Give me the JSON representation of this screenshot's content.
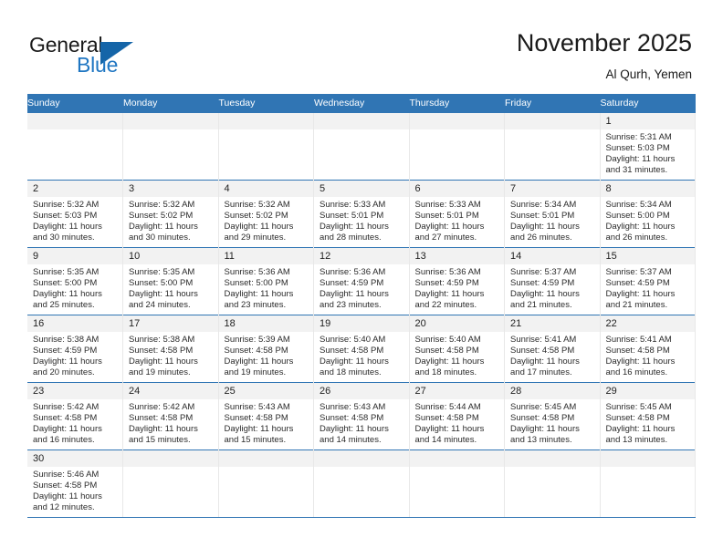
{
  "logo": {
    "word1": "General",
    "word2": "Blue",
    "triangle_color": "#1565a8",
    "blue_color": "#1f76c2",
    "icon": "triangle-flag-icon"
  },
  "header": {
    "title": "November 2025",
    "subtitle": "Al Qurh, Yemen"
  },
  "theme": {
    "header_row_bg": "#3075b4",
    "daynum_strip_bg": "#f2f2f2",
    "row_divider": "#3075b4",
    "column_divider": "#e8e8e8"
  },
  "weekday_headers": [
    "Sunday",
    "Monday",
    "Tuesday",
    "Wednesday",
    "Thursday",
    "Friday",
    "Saturday"
  ],
  "labels": {
    "sunrise": "Sunrise:",
    "sunset": "Sunset:",
    "daylight": "Daylight:"
  },
  "weeks": [
    [
      {
        "day": "",
        "empty": true
      },
      {
        "day": "",
        "empty": true
      },
      {
        "day": "",
        "empty": true
      },
      {
        "day": "",
        "empty": true
      },
      {
        "day": "",
        "empty": true
      },
      {
        "day": "",
        "empty": true
      },
      {
        "day": "1",
        "sunrise": "Sunrise: 5:31 AM",
        "sunset": "Sunset: 5:03 PM",
        "daylight": "Daylight: 11 hours and 31 minutes."
      }
    ],
    [
      {
        "day": "2",
        "sunrise": "Sunrise: 5:32 AM",
        "sunset": "Sunset: 5:03 PM",
        "daylight": "Daylight: 11 hours and 30 minutes."
      },
      {
        "day": "3",
        "sunrise": "Sunrise: 5:32 AM",
        "sunset": "Sunset: 5:02 PM",
        "daylight": "Daylight: 11 hours and 30 minutes."
      },
      {
        "day": "4",
        "sunrise": "Sunrise: 5:32 AM",
        "sunset": "Sunset: 5:02 PM",
        "daylight": "Daylight: 11 hours and 29 minutes."
      },
      {
        "day": "5",
        "sunrise": "Sunrise: 5:33 AM",
        "sunset": "Sunset: 5:01 PM",
        "daylight": "Daylight: 11 hours and 28 minutes."
      },
      {
        "day": "6",
        "sunrise": "Sunrise: 5:33 AM",
        "sunset": "Sunset: 5:01 PM",
        "daylight": "Daylight: 11 hours and 27 minutes."
      },
      {
        "day": "7",
        "sunrise": "Sunrise: 5:34 AM",
        "sunset": "Sunset: 5:01 PM",
        "daylight": "Daylight: 11 hours and 26 minutes."
      },
      {
        "day": "8",
        "sunrise": "Sunrise: 5:34 AM",
        "sunset": "Sunset: 5:00 PM",
        "daylight": "Daylight: 11 hours and 26 minutes."
      }
    ],
    [
      {
        "day": "9",
        "sunrise": "Sunrise: 5:35 AM",
        "sunset": "Sunset: 5:00 PM",
        "daylight": "Daylight: 11 hours and 25 minutes."
      },
      {
        "day": "10",
        "sunrise": "Sunrise: 5:35 AM",
        "sunset": "Sunset: 5:00 PM",
        "daylight": "Daylight: 11 hours and 24 minutes."
      },
      {
        "day": "11",
        "sunrise": "Sunrise: 5:36 AM",
        "sunset": "Sunset: 5:00 PM",
        "daylight": "Daylight: 11 hours and 23 minutes."
      },
      {
        "day": "12",
        "sunrise": "Sunrise: 5:36 AM",
        "sunset": "Sunset: 4:59 PM",
        "daylight": "Daylight: 11 hours and 23 minutes."
      },
      {
        "day": "13",
        "sunrise": "Sunrise: 5:36 AM",
        "sunset": "Sunset: 4:59 PM",
        "daylight": "Daylight: 11 hours and 22 minutes."
      },
      {
        "day": "14",
        "sunrise": "Sunrise: 5:37 AM",
        "sunset": "Sunset: 4:59 PM",
        "daylight": "Daylight: 11 hours and 21 minutes."
      },
      {
        "day": "15",
        "sunrise": "Sunrise: 5:37 AM",
        "sunset": "Sunset: 4:59 PM",
        "daylight": "Daylight: 11 hours and 21 minutes."
      }
    ],
    [
      {
        "day": "16",
        "sunrise": "Sunrise: 5:38 AM",
        "sunset": "Sunset: 4:59 PM",
        "daylight": "Daylight: 11 hours and 20 minutes."
      },
      {
        "day": "17",
        "sunrise": "Sunrise: 5:38 AM",
        "sunset": "Sunset: 4:58 PM",
        "daylight": "Daylight: 11 hours and 19 minutes."
      },
      {
        "day": "18",
        "sunrise": "Sunrise: 5:39 AM",
        "sunset": "Sunset: 4:58 PM",
        "daylight": "Daylight: 11 hours and 19 minutes."
      },
      {
        "day": "19",
        "sunrise": "Sunrise: 5:40 AM",
        "sunset": "Sunset: 4:58 PM",
        "daylight": "Daylight: 11 hours and 18 minutes."
      },
      {
        "day": "20",
        "sunrise": "Sunrise: 5:40 AM",
        "sunset": "Sunset: 4:58 PM",
        "daylight": "Daylight: 11 hours and 18 minutes."
      },
      {
        "day": "21",
        "sunrise": "Sunrise: 5:41 AM",
        "sunset": "Sunset: 4:58 PM",
        "daylight": "Daylight: 11 hours and 17 minutes."
      },
      {
        "day": "22",
        "sunrise": "Sunrise: 5:41 AM",
        "sunset": "Sunset: 4:58 PM",
        "daylight": "Daylight: 11 hours and 16 minutes."
      }
    ],
    [
      {
        "day": "23",
        "sunrise": "Sunrise: 5:42 AM",
        "sunset": "Sunset: 4:58 PM",
        "daylight": "Daylight: 11 hours and 16 minutes."
      },
      {
        "day": "24",
        "sunrise": "Sunrise: 5:42 AM",
        "sunset": "Sunset: 4:58 PM",
        "daylight": "Daylight: 11 hours and 15 minutes."
      },
      {
        "day": "25",
        "sunrise": "Sunrise: 5:43 AM",
        "sunset": "Sunset: 4:58 PM",
        "daylight": "Daylight: 11 hours and 15 minutes."
      },
      {
        "day": "26",
        "sunrise": "Sunrise: 5:43 AM",
        "sunset": "Sunset: 4:58 PM",
        "daylight": "Daylight: 11 hours and 14 minutes."
      },
      {
        "day": "27",
        "sunrise": "Sunrise: 5:44 AM",
        "sunset": "Sunset: 4:58 PM",
        "daylight": "Daylight: 11 hours and 14 minutes."
      },
      {
        "day": "28",
        "sunrise": "Sunrise: 5:45 AM",
        "sunset": "Sunset: 4:58 PM",
        "daylight": "Daylight: 11 hours and 13 minutes."
      },
      {
        "day": "29",
        "sunrise": "Sunrise: 5:45 AM",
        "sunset": "Sunset: 4:58 PM",
        "daylight": "Daylight: 11 hours and 13 minutes."
      }
    ],
    [
      {
        "day": "30",
        "sunrise": "Sunrise: 5:46 AM",
        "sunset": "Sunset: 4:58 PM",
        "daylight": "Daylight: 11 hours and 12 minutes."
      },
      {
        "day": "",
        "empty": true
      },
      {
        "day": "",
        "empty": true
      },
      {
        "day": "",
        "empty": true
      },
      {
        "day": "",
        "empty": true
      },
      {
        "day": "",
        "empty": true
      },
      {
        "day": "",
        "empty": true
      }
    ]
  ]
}
